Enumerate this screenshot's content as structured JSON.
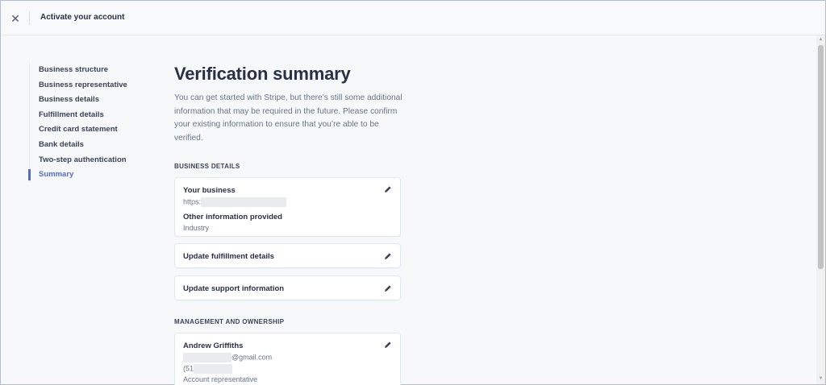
{
  "topbar": {
    "title": "Activate your account",
    "close_glyph": "✕"
  },
  "sidenav": {
    "items": [
      {
        "label": "Business structure"
      },
      {
        "label": "Business representative"
      },
      {
        "label": "Business details"
      },
      {
        "label": "Fulfillment details"
      },
      {
        "label": "Credit card statement"
      },
      {
        "label": "Bank details"
      },
      {
        "label": "Two-step authentication"
      },
      {
        "label": "Summary",
        "active": true
      }
    ]
  },
  "main": {
    "title": "Verification summary",
    "intro": "You can get started with Stripe, but there’s still some additional information that may be required in the future. Please confirm your existing information to ensure that you’re able to be verified.",
    "business_details": {
      "heading": "BUSINESS DETAILS",
      "your_business_label": "Your business",
      "url_prefix": "https:",
      "other_info_label": "Other information provided",
      "other_info_value": "Industry",
      "fulfillment_label": "Update fulfillment details",
      "support_label": "Update support information"
    },
    "management": {
      "heading": "MANAGEMENT AND OWNERSHIP",
      "name": "Andrew Griffiths",
      "email_suffix": "@gmail.com",
      "phone_prefix": "(51",
      "role": "Account representative"
    }
  },
  "colors": {
    "accent": "#5469d4",
    "background": "#f6f8fa",
    "card": "#ffffff"
  },
  "icons": {
    "edit": "pencil-icon",
    "close": "close-icon"
  }
}
